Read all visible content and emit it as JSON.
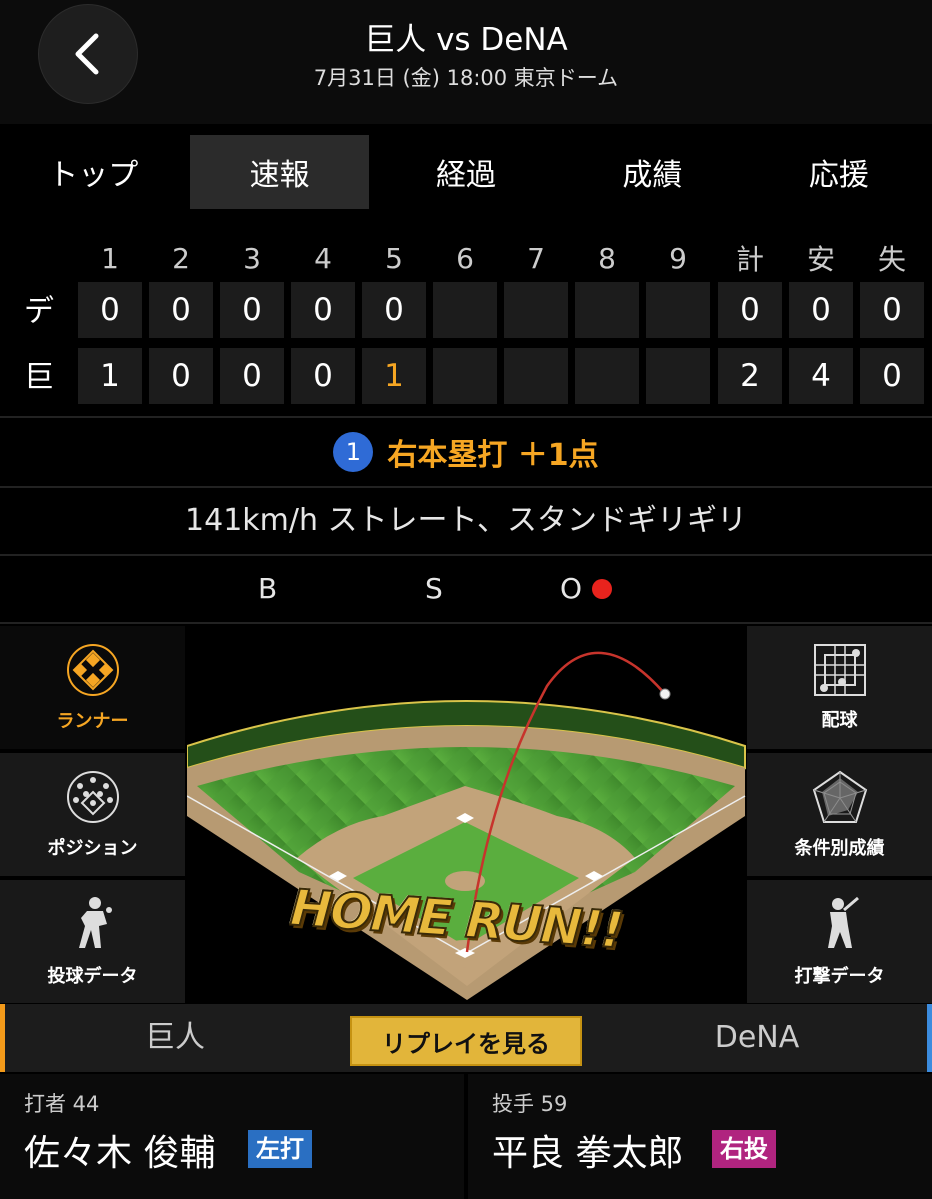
{
  "header": {
    "title": "巨人 vs DeNA",
    "subtitle": "7月31日 (金) 18:00 東京ドーム"
  },
  "tabs": [
    {
      "label": "トップ",
      "active": false
    },
    {
      "label": "速報",
      "active": true
    },
    {
      "label": "経過",
      "active": false
    },
    {
      "label": "成績",
      "active": false
    },
    {
      "label": "応援",
      "active": false
    }
  ],
  "scoreboard": {
    "headers": [
      "1",
      "2",
      "3",
      "4",
      "5",
      "6",
      "7",
      "8",
      "9",
      "計",
      "安",
      "失"
    ],
    "rows": [
      {
        "team": "デ",
        "cells": [
          "0",
          "0",
          "0",
          "0",
          "0",
          "",
          "",
          "",
          "",
          "0",
          "0",
          "0"
        ]
      },
      {
        "team": "巨",
        "cells": [
          "1",
          "0",
          "0",
          "0",
          "1",
          "",
          "",
          "",
          "",
          "2",
          "4",
          "0"
        ]
      }
    ],
    "highlight_color": "#f6a623"
  },
  "play": {
    "badge": "1",
    "text": "右本塁打 ＋1点"
  },
  "pitch_description": "141km/h ストレート、スタンドギリギリ",
  "count": {
    "ball_label": "B",
    "strike_label": "S",
    "out_label": "O",
    "outs": 1
  },
  "side_menu_left": [
    {
      "label": "ランナー",
      "icon": "diamond-bases-icon",
      "active": true
    },
    {
      "label": "ポジション",
      "icon": "field-positions-icon",
      "active": false
    },
    {
      "label": "投球データ",
      "icon": "pitcher-icon",
      "active": false
    }
  ],
  "side_menu_right": [
    {
      "label": "配球",
      "icon": "strike-zone-grid-icon"
    },
    {
      "label": "条件別成績",
      "icon": "radar-chart-icon"
    },
    {
      "label": "打撃データ",
      "icon": "batter-icon"
    }
  ],
  "field": {
    "overlay_text": "HOME RUN!!"
  },
  "bottom_bar": {
    "home_team": "巨人",
    "replay_label": "リプレイを見る",
    "away_team": "DeNA"
  },
  "batter": {
    "role": "打者 44",
    "name": "佐々木 俊輔",
    "hand": "左打",
    "hand_color": "#2a6fc2"
  },
  "pitcher": {
    "role": "投手 59",
    "name": "平良 拳太郎",
    "hand": "右投",
    "hand_color": "#b0247f"
  }
}
